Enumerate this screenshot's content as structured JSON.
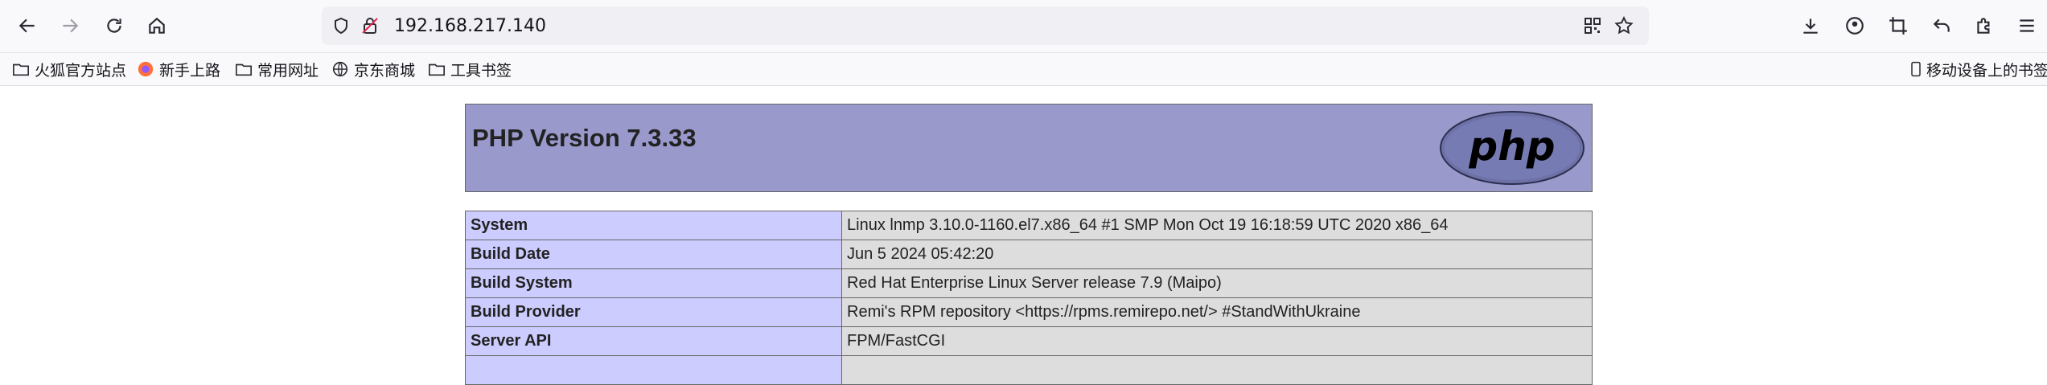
{
  "browser": {
    "url": "192.168.217.140",
    "bookmarks": [
      "火狐官方站点",
      "新手上路",
      "常用网址",
      "京东商城",
      "工具书签"
    ],
    "mobile_bookmarks": "移动设备上的书签"
  },
  "page": {
    "title": "PHP Version 7.3.33",
    "logo_text": "php",
    "rows": [
      {
        "key": "System",
        "value": "Linux lnmp 3.10.0-1160.el7.x86_64 #1 SMP Mon Oct 19 16:18:59 UTC 2020 x86_64"
      },
      {
        "key": "Build Date",
        "value": "Jun 5 2024 05:42:20"
      },
      {
        "key": "Build System",
        "value": "Red Hat Enterprise Linux Server release 7.9 (Maipo)"
      },
      {
        "key": "Build Provider",
        "value": "Remi's RPM repository <https://rpms.remirepo.net/> #StandWithUkraine"
      },
      {
        "key": "Server API",
        "value": "FPM/FastCGI"
      },
      {
        "key": "",
        "value": ""
      }
    ]
  },
  "colors": {
    "header_bg": "#9999cc",
    "key_bg": "#ccccff",
    "value_bg": "#dddddd"
  }
}
